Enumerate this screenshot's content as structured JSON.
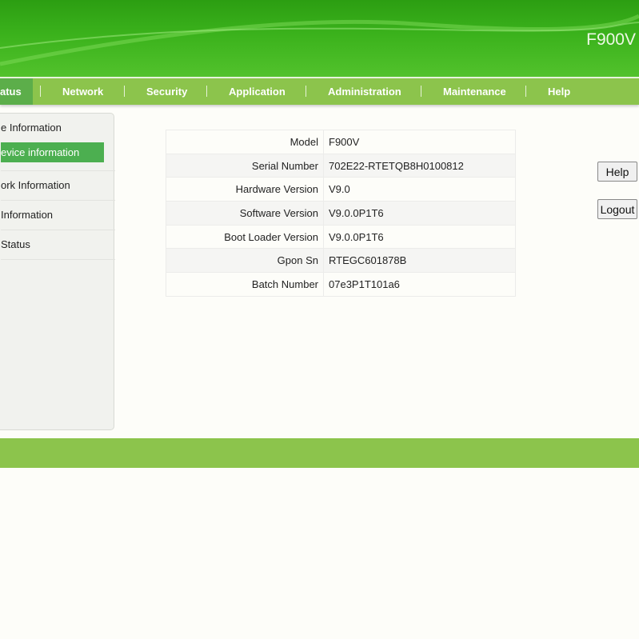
{
  "header": {
    "model": "F900V"
  },
  "nav": {
    "tabs": [
      "atus",
      "Network",
      "Security",
      "Application",
      "Administration",
      "Maintenance",
      "Help"
    ]
  },
  "sidebar": {
    "items": [
      "e Information",
      "evice information",
      "ork Information",
      "Information",
      "Status"
    ]
  },
  "device_info": {
    "rows": [
      {
        "label": "Model",
        "value": "F900V"
      },
      {
        "label": "Serial Number",
        "value": "702E22-RTETQB8H0100812"
      },
      {
        "label": "Hardware Version",
        "value": "V9.0"
      },
      {
        "label": "Software Version",
        "value": "V9.0.0P1T6"
      },
      {
        "label": "Boot Loader Version",
        "value": "V9.0.0P1T6"
      },
      {
        "label": "Gpon Sn",
        "value": "RTEGC601878B"
      },
      {
        "label": "Batch Number",
        "value": "07e3P1T101a6"
      }
    ]
  },
  "buttons": {
    "help": "Help",
    "logout": "Logout"
  }
}
